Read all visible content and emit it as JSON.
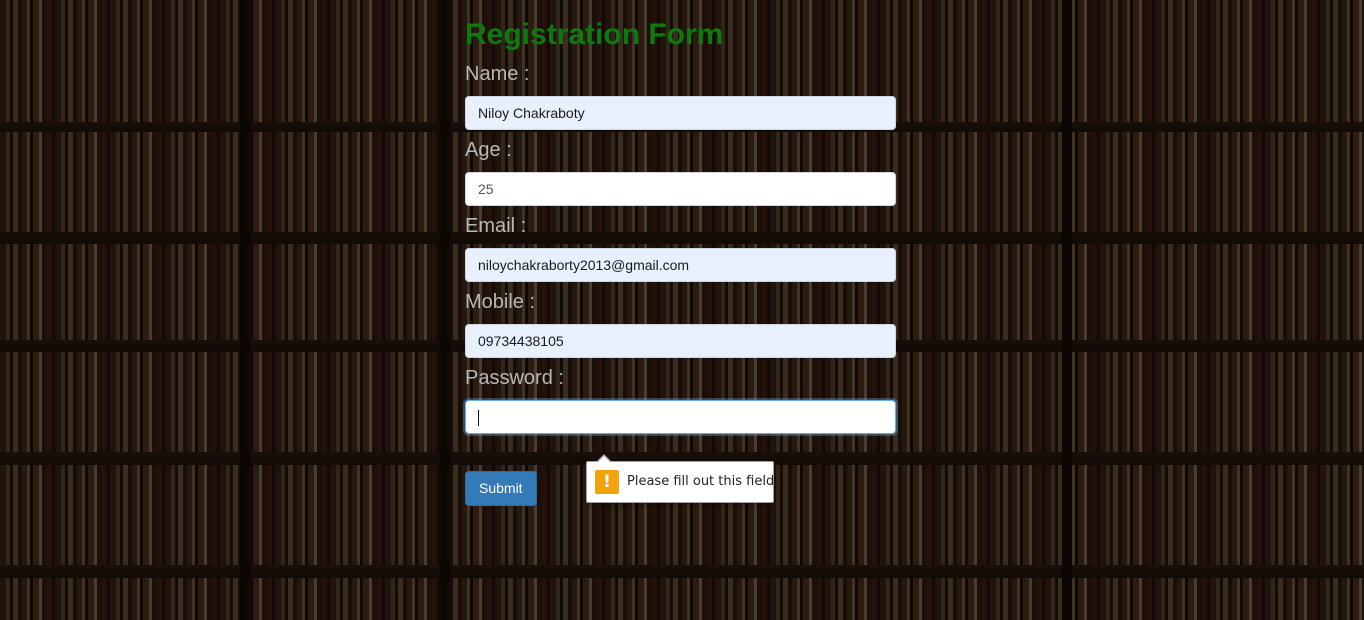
{
  "form": {
    "title": "Registration Form",
    "fields": [
      {
        "label": "Name :",
        "value": "Niloy Chakraboty"
      },
      {
        "label": "Age :",
        "value": "25"
      },
      {
        "label": "Email :",
        "value": "niloychakraborty2013@gmail.com"
      },
      {
        "label": "Mobile :",
        "value": "09734438105"
      },
      {
        "label": "Password :",
        "value": ""
      }
    ],
    "submit_label": "Submit"
  },
  "validation_tooltip": {
    "message": "Please fill out this field.",
    "icon": "warning-icon"
  },
  "colors": {
    "title": "#0e7a0e",
    "label": "#b8b8b8",
    "autofill_bg": "#e8f0fe",
    "button": "#337ab7",
    "warning": "#f0a30a"
  }
}
